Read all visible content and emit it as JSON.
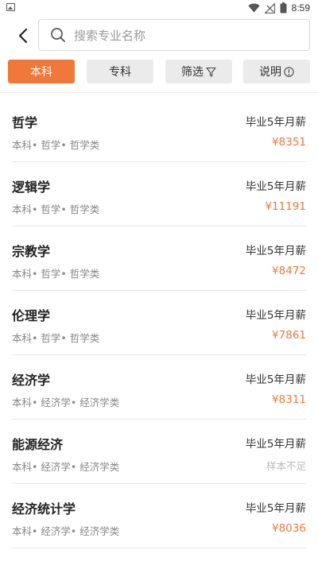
{
  "status_bar": {
    "time": "8:59"
  },
  "search": {
    "placeholder": "搜索专业名称"
  },
  "filters": [
    {
      "label": "本科",
      "active": true
    },
    {
      "label": "专科",
      "active": false
    },
    {
      "label": "筛选",
      "active": false
    },
    {
      "label": "说明",
      "active": false
    }
  ],
  "majors": [
    {
      "name": "哲学",
      "path": "本科• 哲学• 哲学类",
      "salary_label": "毕业5年月薪",
      "salary": "¥8351"
    },
    {
      "name": "逻辑学",
      "path": "本科• 哲学• 哲学类",
      "salary_label": "毕业5年月薪",
      "salary": "¥11191"
    },
    {
      "name": "宗教学",
      "path": "本科• 哲学• 哲学类",
      "salary_label": "毕业5年月薪",
      "salary": "¥8472"
    },
    {
      "name": "伦理学",
      "path": "本科• 哲学• 哲学类",
      "salary_label": "毕业5年月薪",
      "salary": "¥7861"
    },
    {
      "name": "经济学",
      "path": "本科• 经济学• 经济学类",
      "salary_label": "毕业5年月薪",
      "salary": "¥8311"
    },
    {
      "name": "能源经济",
      "path": "本科• 经济学• 经济学类",
      "salary_label": "毕业5年月薪",
      "salary": "样本不足"
    },
    {
      "name": "经济统计学",
      "path": "本科• 经济学• 经济学类",
      "salary_label": "毕业5年月薪",
      "salary": "¥8036"
    }
  ],
  "colors": {
    "accent": "#f0783a",
    "muted": "#bbbbbb"
  }
}
